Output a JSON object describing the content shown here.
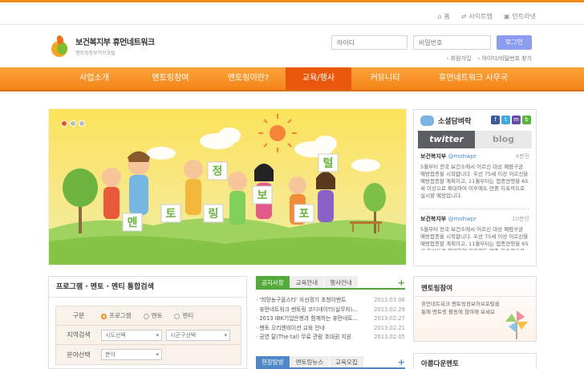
{
  "util": {
    "home": "홈",
    "sitemap": "사이트맵",
    "intranet": "인트라넷"
  },
  "logo": {
    "title": "보건복지부 휴먼네트워크",
    "subtitle": "멘토링정보허브포털"
  },
  "login": {
    "id_placeholder": "아이디",
    "pw_placeholder": "비밀번호",
    "button": "로그인",
    "join": "회원가입",
    "find": "아이디/비밀번호 찾기"
  },
  "nav": {
    "items": [
      "사업소개",
      "멘토링참여",
      "멘토링이란?",
      "교육/행사",
      "커뮤니티",
      "휴먼네트워크 사무국"
    ],
    "active_index": 3
  },
  "banner": {
    "letters": [
      "멘",
      "토",
      "링",
      "정",
      "보",
      "포",
      "털"
    ]
  },
  "social": {
    "title": "소셜담벼락",
    "tabs": {
      "twitter": "twitter",
      "blog": "blog"
    },
    "sns": [
      "f",
      "t",
      "m",
      "b"
    ],
    "tweets": [
      {
        "name": "보건복지부",
        "handle": "@mohwpr",
        "time": "4분전",
        "text": "5월부터 전국 보건소에서 어르신 대상 폐렴구균 예방접종을 시작합니다. 우선 75세 이상 어르신을 예방접종할 계획이고, 11월부터는 접종연령을 65세 이상으로 확대하여 이후에도 연중 지속적으로 실시할 예정입니다."
      },
      {
        "name": "보건복지부",
        "handle": "@mohwpr",
        "time": "10분전",
        "text": "5월부터 전국 보건소에서 어르신 대상 폐렴구균 예방접종을 시작합니다. 우선 75세 이상 어르신을 예방접종할 계획이고, 11월부터는 접종연령을 65세 이상으로 확대하여 이후에도 연중 지속적으로 실시할 예정입니다."
      }
    ]
  },
  "search": {
    "title": "프로그램 · 멘토 · 멘티 통합검색",
    "row1_label": "구분",
    "options": [
      "프로그램",
      "멘토",
      "멘티"
    ],
    "row2_label": "지역검색",
    "city_select": "시도선택",
    "district_select": "시군구선택",
    "row3_label": "분야선택",
    "field_select": "분야"
  },
  "notice": {
    "tabs": [
      "공지사항",
      "교육안내",
      "행사안내"
    ],
    "items": [
      {
        "title": "'희망농구올스타' 자선경기 초청이벤트",
        "date": "2013.03.06"
      },
      {
        "title": "휴먼네트워크 멘토링 코디네이터(실무자)...",
        "date": "2013.02.29"
      },
      {
        "title": "2013 IBK기업은행과 함께하는 휴먼네트...",
        "date": "2013.02.27"
      },
      {
        "title": "멘토 오리엔테이션 교육 안내",
        "date": "2013.02.21"
      },
      {
        "title": "공연 탈(The tal) 무료 관람 초대권 지원",
        "date": "2013.02.05"
      }
    ],
    "tabs2": [
      "현장탐방",
      "멘토링뉴스",
      "교육모집"
    ]
  },
  "mentor": {
    "title": "멘토링참여",
    "text": "휴먼네트워크 멘토링정보허브포털을 통해 멘토링 활동에 참여해 보세요",
    "title2": "아름다운멘토"
  },
  "colors": {
    "orange": "#f5851a",
    "active": "#e8570c",
    "green": "#54a93b",
    "blue": "#4f88c9"
  }
}
